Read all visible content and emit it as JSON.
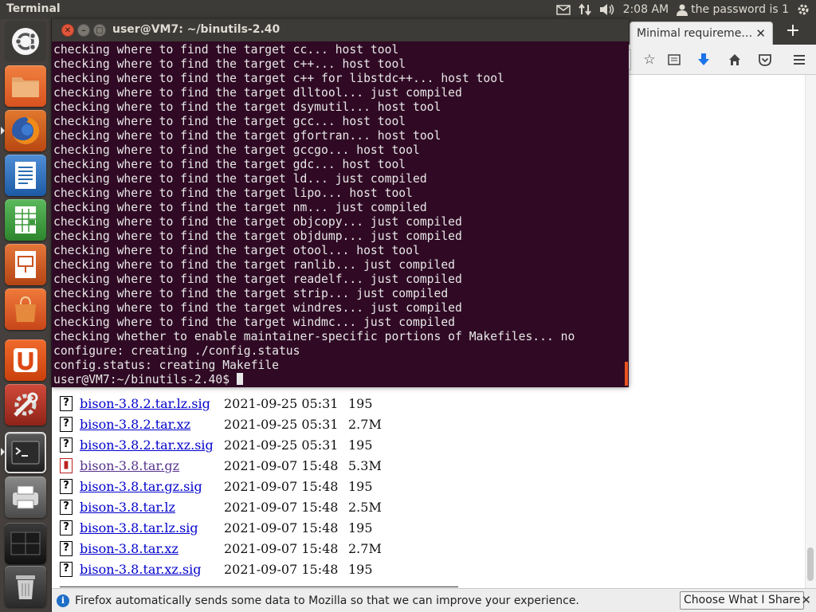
{
  "top_panel": {
    "app_title": "Terminal",
    "clock": "2:08 AM",
    "user_label": "the password is 1"
  },
  "launcher": {
    "items": [
      {
        "name": "dash-home",
        "color": "#f08a5d"
      },
      {
        "name": "files",
        "color": "#e2582e"
      },
      {
        "name": "firefox",
        "color": "#e66000"
      },
      {
        "name": "libreoffice-writer",
        "color": "#2a6fb4"
      },
      {
        "name": "libreoffice-calc",
        "color": "#3d9a3d"
      },
      {
        "name": "libreoffice-impress",
        "color": "#c9541f"
      },
      {
        "name": "ubuntu-software",
        "color": "#dd5a22"
      },
      {
        "name": "ubuntu-one",
        "color": "#e04e16"
      },
      {
        "name": "system-settings",
        "color": "#c0392b"
      },
      {
        "name": "terminal",
        "color": "#2c2c2c"
      },
      {
        "name": "printer",
        "color": "#6a6a6a"
      },
      {
        "name": "workspace-switcher",
        "color": "#222222"
      },
      {
        "name": "trash",
        "color": "#444444"
      }
    ]
  },
  "firefox": {
    "tab_title": "Minimal requireme…",
    "file_rows": [
      {
        "name": "bison-3.8.2.tar.lz.sig",
        "date": "2021-09-25 05:31",
        "size": "195",
        "icon": "?",
        "visited": false
      },
      {
        "name": "bison-3.8.2.tar.xz",
        "date": "2021-09-25 05:31",
        "size": "2.7M",
        "icon": "?",
        "visited": false
      },
      {
        "name": "bison-3.8.2.tar.xz.sig",
        "date": "2021-09-25 05:31",
        "size": "195",
        "icon": "?",
        "visited": false
      },
      {
        "name": "bison-3.8.tar.gz",
        "date": "2021-09-07 15:48",
        "size": "5.3M",
        "icon": "pkg",
        "visited": true
      },
      {
        "name": "bison-3.8.tar.gz.sig",
        "date": "2021-09-07 15:48",
        "size": "195",
        "icon": "?",
        "visited": false
      },
      {
        "name": "bison-3.8.tar.lz",
        "date": "2021-09-07 15:48",
        "size": "2.5M",
        "icon": "?",
        "visited": false
      },
      {
        "name": "bison-3.8.tar.lz.sig",
        "date": "2021-09-07 15:48",
        "size": "195",
        "icon": "?",
        "visited": false
      },
      {
        "name": "bison-3.8.tar.xz",
        "date": "2021-09-07 15:48",
        "size": "2.7M",
        "icon": "?",
        "visited": false
      },
      {
        "name": "bison-3.8.tar.xz.sig",
        "date": "2021-09-07 15:48",
        "size": "195",
        "icon": "?",
        "visited": false
      }
    ],
    "notification": {
      "text": "Firefox automatically sends some data to Mozilla so that we can improve your experience.",
      "button": "Choose What I Share"
    }
  },
  "terminal": {
    "title": "user@VM7: ~/binutils-2.40",
    "lines": [
      "checking where to find the target cc... host tool",
      "checking where to find the target c++... host tool",
      "checking where to find the target c++ for libstdc++... host tool",
      "checking where to find the target dlltool... just compiled",
      "checking where to find the target dsymutil... host tool",
      "checking where to find the target gcc... host tool",
      "checking where to find the target gfortran... host tool",
      "checking where to find the target gccgo... host tool",
      "checking where to find the target gdc... host tool",
      "checking where to find the target ld... just compiled",
      "checking where to find the target lipo... host tool",
      "checking where to find the target nm... just compiled",
      "checking where to find the target objcopy... just compiled",
      "checking where to find the target objdump... just compiled",
      "checking where to find the target otool... host tool",
      "checking where to find the target ranlib... just compiled",
      "checking where to find the target readelf... just compiled",
      "checking where to find the target strip... just compiled",
      "checking where to find the target windres... just compiled",
      "checking where to find the target windmc... just compiled",
      "checking whether to enable maintainer-specific portions of Makefiles... no",
      "configure: creating ./config.status",
      "config.status: creating Makefile"
    ],
    "prompt": "user@VM7:~/binutils-2.40$ "
  }
}
